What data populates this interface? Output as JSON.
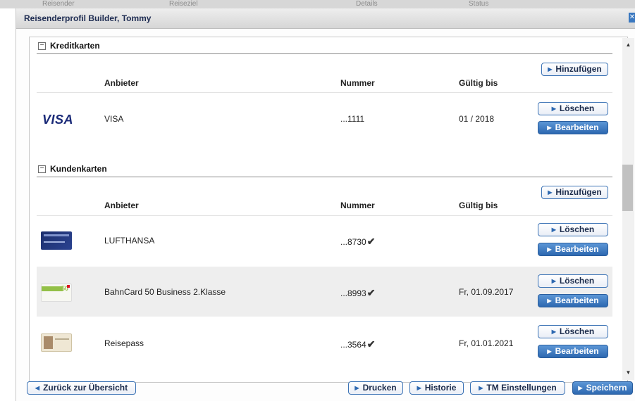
{
  "background_tabs": [
    "Reisender",
    "Reiseziel",
    "Details",
    "Status"
  ],
  "dialog": {
    "title": "Reisenderprofil Builder, Tommy"
  },
  "credit_cards": {
    "heading": "Kreditkarten",
    "add_label": "Hinzufügen",
    "columns": {
      "provider": "Anbieter",
      "number": "Nummer",
      "valid": "Gültig bis"
    },
    "rows": [
      {
        "logo_text": "VISA",
        "provider": "VISA",
        "number": "...1111",
        "valid": "01 / 2018",
        "delete": "Löschen",
        "edit": "Bearbeiten"
      }
    ]
  },
  "customer_cards": {
    "heading": "Kundenkarten",
    "add_label": "Hinzufügen",
    "columns": {
      "provider": "Anbieter",
      "number": "Nummer",
      "valid": "Gültig bis"
    },
    "rows": [
      {
        "icon": "lufthansa-card-image",
        "provider": "LUFTHANSA",
        "number": "...8730",
        "verified": true,
        "valid": "",
        "delete": "Löschen",
        "edit": "Bearbeiten"
      },
      {
        "icon": "bahncard-image",
        "provider": "BahnCard 50 Business 2.Klasse",
        "number": "...8993",
        "verified": true,
        "valid": "Fr, 01.09.2017",
        "delete": "Löschen",
        "edit": "Bearbeiten",
        "highlighted": true
      },
      {
        "icon": "passport-image",
        "provider": "Reisepass",
        "number": "...3564",
        "verified": true,
        "valid": "Fr, 01.01.2021",
        "delete": "Löschen",
        "edit": "Bearbeiten"
      }
    ]
  },
  "footer": {
    "back": "Zurück zur Übersicht",
    "print": "Drucken",
    "history": "Historie",
    "tm_settings": "TM Einstellungen",
    "save": "Speichern"
  },
  "colors": {
    "accent": "#2d68b0",
    "title": "#1e2c52",
    "row_highlight": "#eeeeee"
  }
}
